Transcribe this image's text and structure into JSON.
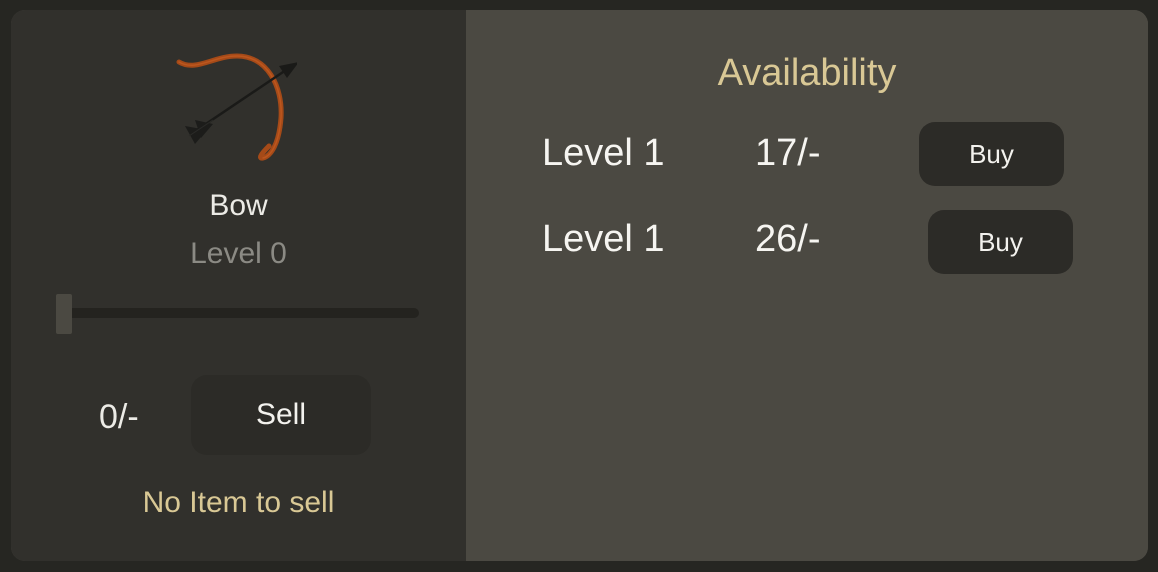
{
  "item": {
    "name": "Bow",
    "level": "Level 0",
    "icon": "bow-and-arrow-icon",
    "level_progress": 0
  },
  "sell": {
    "price": "0/-",
    "button_label": "Sell",
    "status": "No Item to sell"
  },
  "availability": {
    "title": "Availability",
    "offers": [
      {
        "level": "Level 1",
        "price": "17/-",
        "button_label": "Buy"
      },
      {
        "level": "Level 1",
        "price": "26/-",
        "button_label": "Buy"
      }
    ]
  },
  "colors": {
    "page_background": "#262622",
    "left_panel": "#31302c",
    "right_panel": "#4b4942",
    "button": "#2c2b27",
    "accent_gold": "#d9c895",
    "muted_text": "#8b8a84",
    "bow_wood": "#a54a18"
  }
}
